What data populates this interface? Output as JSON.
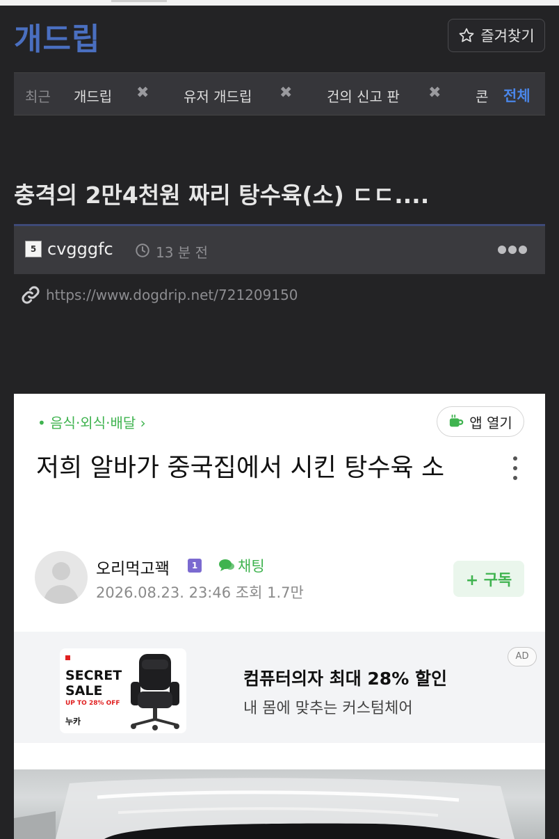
{
  "header": {
    "site_title": "개드립",
    "favorite_label": "즐겨찾기"
  },
  "recent": {
    "label": "최근",
    "items": [
      "개드립",
      "유저 개드립",
      "건의 신고 판",
      "콘"
    ],
    "close_glyph": "✖",
    "all_label": "전체"
  },
  "post": {
    "title": "충격의 2만4천원 짜리 탕수육(소) ㄷㄷ....",
    "author_badge": "5",
    "author": "cvgggfc",
    "time": "13 분 전",
    "url": "https://www.dogdrip.net/721209150"
  },
  "embed": {
    "category": "• 음식·외식·배달 ›",
    "app_open_label": "앱 열기",
    "headline": "저희 알바가 중국집에서 시킨 탕수육 소",
    "author_name": "오리먹고꽥",
    "author_level": "1",
    "chat_label": "채팅",
    "date_views": "2026.08.23. 23:46 조회 1.7만",
    "subscribe_label": "+ 구독",
    "ad": {
      "thumb_line1": "SECRET",
      "thumb_line2": "SALE",
      "thumb_sub": "UP TO 28% OFF",
      "thumb_brand": "누카",
      "title": "컴퓨터의자 최대 28% 할인",
      "desc": "내 몸에 맞추는 커스텀체어",
      "tag": "AD"
    }
  },
  "colors": {
    "background": "#232325",
    "brand": "#4a6fc0",
    "accent_blue": "#4a86e8",
    "embed_green": "#3fb34f"
  }
}
